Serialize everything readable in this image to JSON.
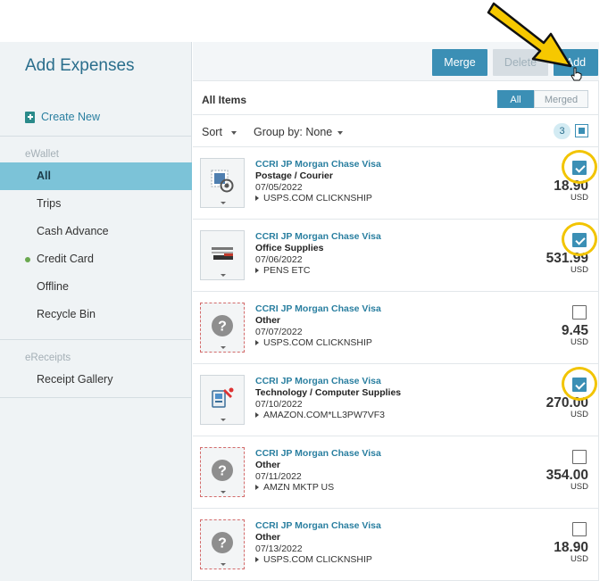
{
  "sidebar": {
    "title": "Add Expenses",
    "create_new": "Create New",
    "ewallet_section": "eWallet",
    "items": [
      {
        "label": "All",
        "active": true
      },
      {
        "label": "Trips"
      },
      {
        "label": "Cash Advance"
      },
      {
        "label": "Credit Card",
        "dot": true
      },
      {
        "label": "Offline"
      },
      {
        "label": "Recycle Bin"
      }
    ],
    "ereceipts_section": "eReceipts",
    "receipt_gallery": "Receipt Gallery"
  },
  "toolbar": {
    "merge_label": "Merge",
    "delete_label": "Delete",
    "add_label": "Add"
  },
  "list": {
    "title": "All Items",
    "filter_all": "All",
    "filter_merged": "Merged",
    "sort_label": "Sort",
    "group_label": "Group by: None",
    "selected_count": "3"
  },
  "expenses": [
    {
      "vendor": "CCRI JP Morgan Chase Visa",
      "type": "Postage / Courier",
      "date": "07/05/2022",
      "merchant": "USPS.COM CLICKNSHIP",
      "amount": "18.90",
      "currency": "USD",
      "checked": true,
      "icon": "stamp-icon"
    },
    {
      "vendor": "CCRI JP Morgan Chase Visa",
      "type": "Office Supplies",
      "date": "07/06/2022",
      "merchant": "PENS ETC",
      "amount": "531.99",
      "currency": "USD",
      "checked": true,
      "icon": "stapler-icon"
    },
    {
      "vendor": "CCRI JP Morgan Chase Visa",
      "type": "Other",
      "date": "07/07/2022",
      "merchant": "USPS.COM CLICKNSHIP",
      "amount": "9.45",
      "currency": "USD",
      "checked": false,
      "icon": "question-icon"
    },
    {
      "vendor": "CCRI JP Morgan Chase Visa",
      "type": "Technology / Computer Supplies",
      "date": "07/10/2022",
      "merchant": "AMAZON.COM*LL3PW7VF3",
      "amount": "270.00",
      "currency": "USD",
      "checked": true,
      "icon": "computer-icon"
    },
    {
      "vendor": "CCRI JP Morgan Chase Visa",
      "type": "Other",
      "date": "07/11/2022",
      "merchant": "AMZN MKTP US",
      "amount": "354.00",
      "currency": "USD",
      "checked": false,
      "icon": "question-icon"
    },
    {
      "vendor": "CCRI JP Morgan Chase Visa",
      "type": "Other",
      "date": "07/13/2022",
      "merchant": "USPS.COM CLICKNSHIP",
      "amount": "18.90",
      "currency": "USD",
      "checked": false,
      "icon": "question-icon"
    }
  ],
  "colors": {
    "accent": "#3b8fb5",
    "highlight": "#f2c400",
    "sidebar_active": "#7cc3d8"
  }
}
